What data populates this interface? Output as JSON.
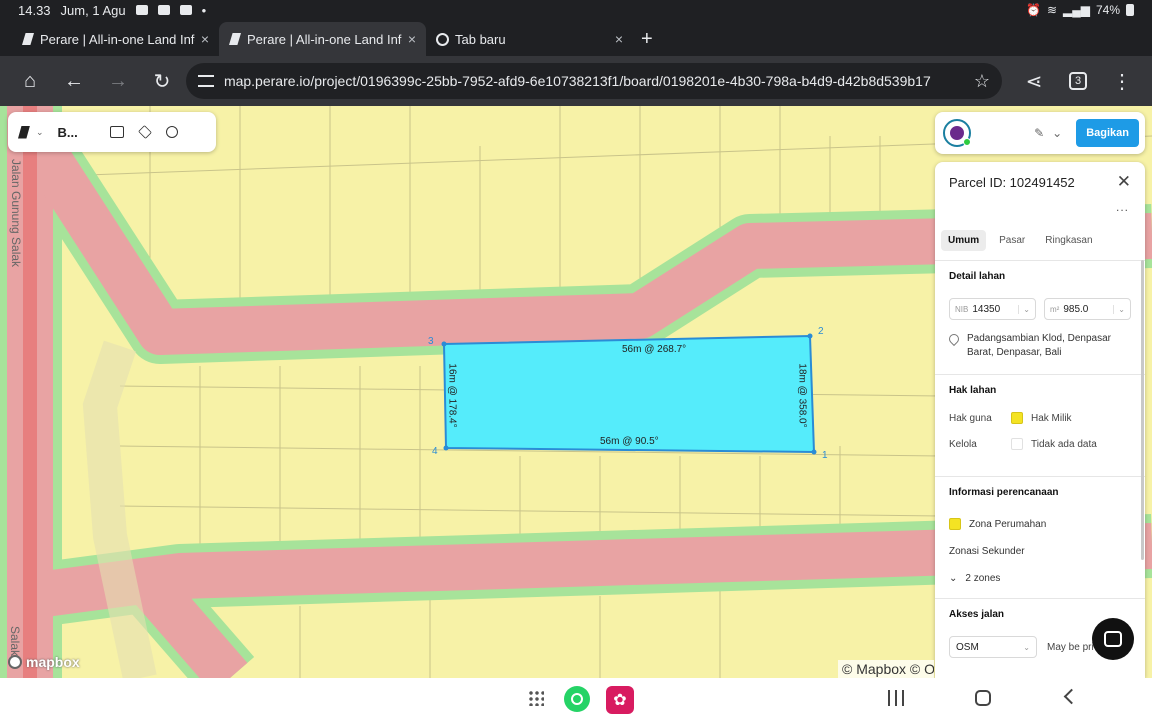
{
  "statusbar": {
    "time": "14.33",
    "date": "Jum, 1 Agu",
    "battery": "74%"
  },
  "tabs": [
    {
      "label": "Perare | All-in-one Land Info",
      "close": "×"
    },
    {
      "label": "Perare | All-in-one Land Info",
      "close": "×"
    },
    {
      "label": "Tab baru",
      "close": "×"
    }
  ],
  "newtab": "+",
  "toolbar": {
    "url": "map.perare.io/project/0196399c-25bb-7952-afd9-6e10738213f1/board/0198201e-4b30-798a-b4d9-d42b8d539b17",
    "tab_count": "3"
  },
  "map": {
    "board_label": "B...",
    "road_label": "Jalan Gunung Salak",
    "road_label_2": "Salak",
    "parcel": {
      "edges": [
        "56m @ 268.7°",
        "18m @ 358.0°",
        "56m @ 90.5°",
        "16m @ 178.4°"
      ],
      "vertices": [
        "1",
        "2",
        "3",
        "4"
      ]
    },
    "mapbox_logo": "mapbox",
    "attribution": "© Mapbox © Op"
  },
  "share_button": "Bagikan",
  "panel": {
    "title": "Parcel ID: 102491452",
    "more": "...",
    "tabs": [
      "Umum",
      "Pasar",
      "Ringkasan"
    ],
    "detail": {
      "title": "Detail lahan",
      "nib_prefix": "NIB",
      "nib": "14350",
      "area_prefix": "m²",
      "area": "985.0",
      "address": "Padangsambian Klod, Denpasar Barat, Denpasar, Bali"
    },
    "hak": {
      "title": "Hak lahan",
      "hak_guna_label": "Hak guna",
      "hak_guna_value": "Hak Milik",
      "kelola_label": "Kelola",
      "kelola_value": "Tidak ada data"
    },
    "perencanaan": {
      "title": "Informasi perencanaan",
      "zone": "Zona Perumahan",
      "secondary": "Zonasi Sekunder",
      "zones_count": "2 zones"
    },
    "akses": {
      "title": "Akses jalan",
      "source": "OSM",
      "note": "May be pri"
    }
  },
  "colors": {
    "parcel_fill": "#55ecfb",
    "parcel_stroke": "#2a8cd6",
    "road_fill": "#e8a0a0",
    "land_fill": "#f7f2a7",
    "accent": "#1e9be6"
  }
}
